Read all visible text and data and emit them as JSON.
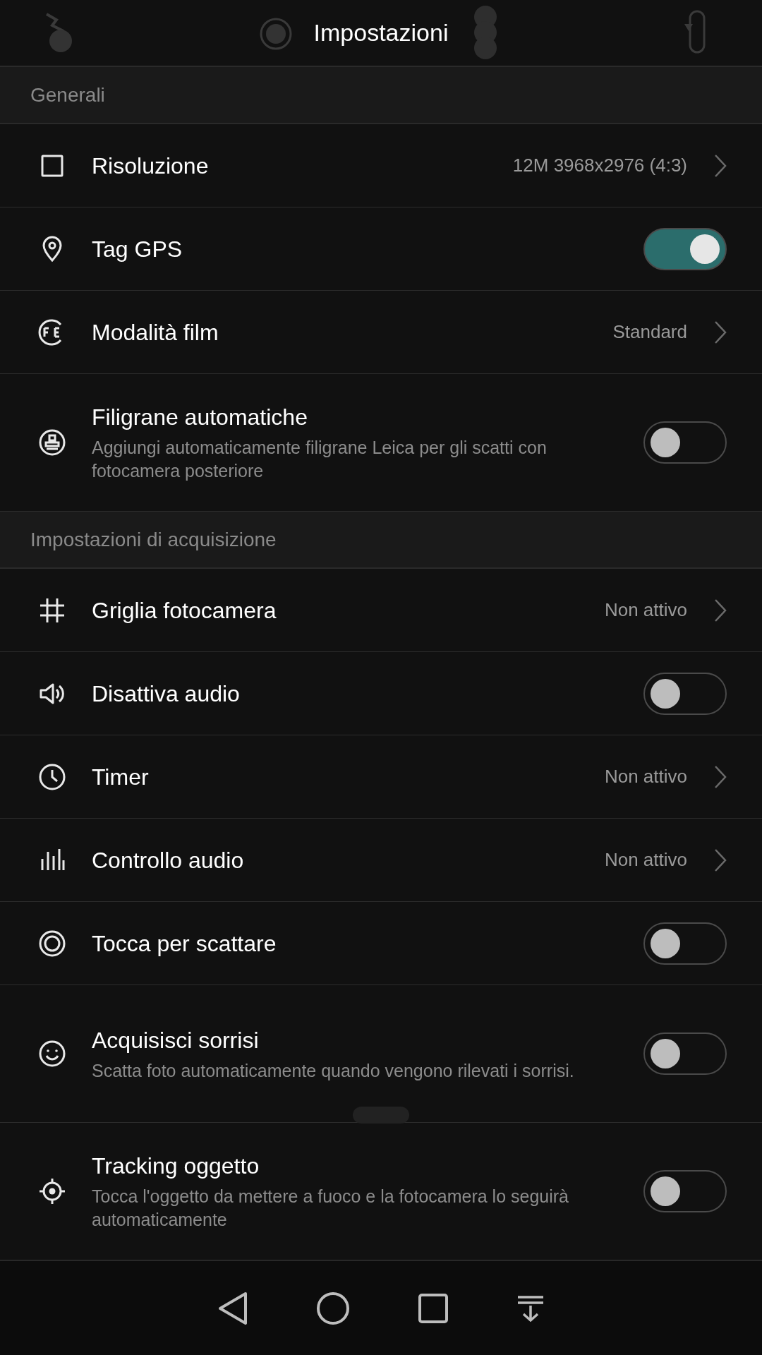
{
  "header": {
    "title": "Impostazioni"
  },
  "sections": [
    {
      "title": "Generali",
      "items": [
        {
          "title": "Risoluzione",
          "kind": "value",
          "value": "12M 3968x2976 (4:3)"
        },
        {
          "title": "Tag GPS",
          "kind": "switch",
          "on": true
        },
        {
          "title": "Modalità film",
          "kind": "value",
          "value": "Standard"
        },
        {
          "title": "Filigrane automatiche",
          "kind": "switch",
          "on": false,
          "subtitle": "Aggiungi automaticamente filigrane Leica per gli scatti con fotocamera posteriore"
        }
      ]
    },
    {
      "title": "Impostazioni di acquisizione",
      "items": [
        {
          "title": "Griglia fotocamera",
          "kind": "value",
          "value": "Non attivo"
        },
        {
          "title": "Disattiva audio",
          "kind": "switch",
          "on": false
        },
        {
          "title": "Timer",
          "kind": "value",
          "value": "Non attivo"
        },
        {
          "title": "Controllo audio",
          "kind": "value",
          "value": "Non attivo"
        },
        {
          "title": "Tocca per scattare",
          "kind": "switch",
          "on": false
        },
        {
          "title": "Acquisisci sorrisi",
          "kind": "switch",
          "on": false,
          "subtitle": "Scatta foto automaticamente quando vengono rilevati i sorrisi."
        },
        {
          "title": "Tracking oggetto",
          "kind": "switch",
          "on": false,
          "subtitle": "Tocca l'oggetto da mettere a fuoco e la fotocamera lo seguirà automaticamente"
        }
      ]
    }
  ]
}
